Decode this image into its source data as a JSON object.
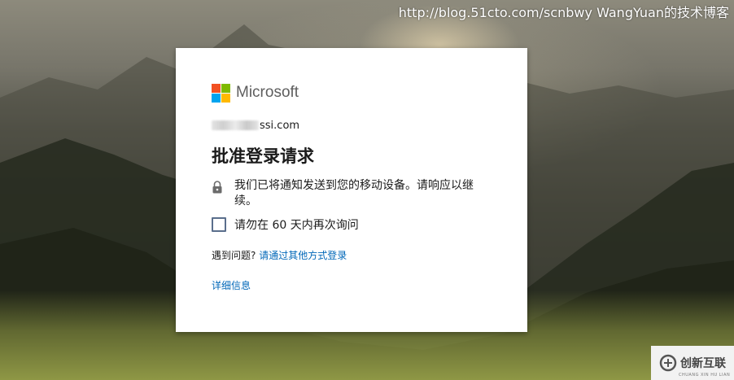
{
  "watermark": "http://blog.51cto.com/scnbwy WangYuan的技术博客",
  "dialog": {
    "brand": "Microsoft",
    "account_suffix": "ssi.com",
    "title": "批准登录请求",
    "notice": "我们已将通知发送到您的移动设备。请响应以继续。",
    "remember_label": "请勿在 60 天内再次询问",
    "remember_checked": false,
    "problem_prefix": "遇到问题?",
    "problem_link": "请通过其他方式登录",
    "details_link": "详细信息"
  },
  "colors": {
    "ms_red": "#f25022",
    "ms_green": "#7fba00",
    "ms_blue": "#00a4ef",
    "ms_yellow": "#ffb900",
    "link": "#0067b8"
  },
  "corner_badge": {
    "name": "创新互联",
    "sub": "CHUANG XIN HU LIAN"
  },
  "icons": [
    "lock-icon",
    "microsoft-logo-icon",
    "chuangxin-logo-icon"
  ]
}
